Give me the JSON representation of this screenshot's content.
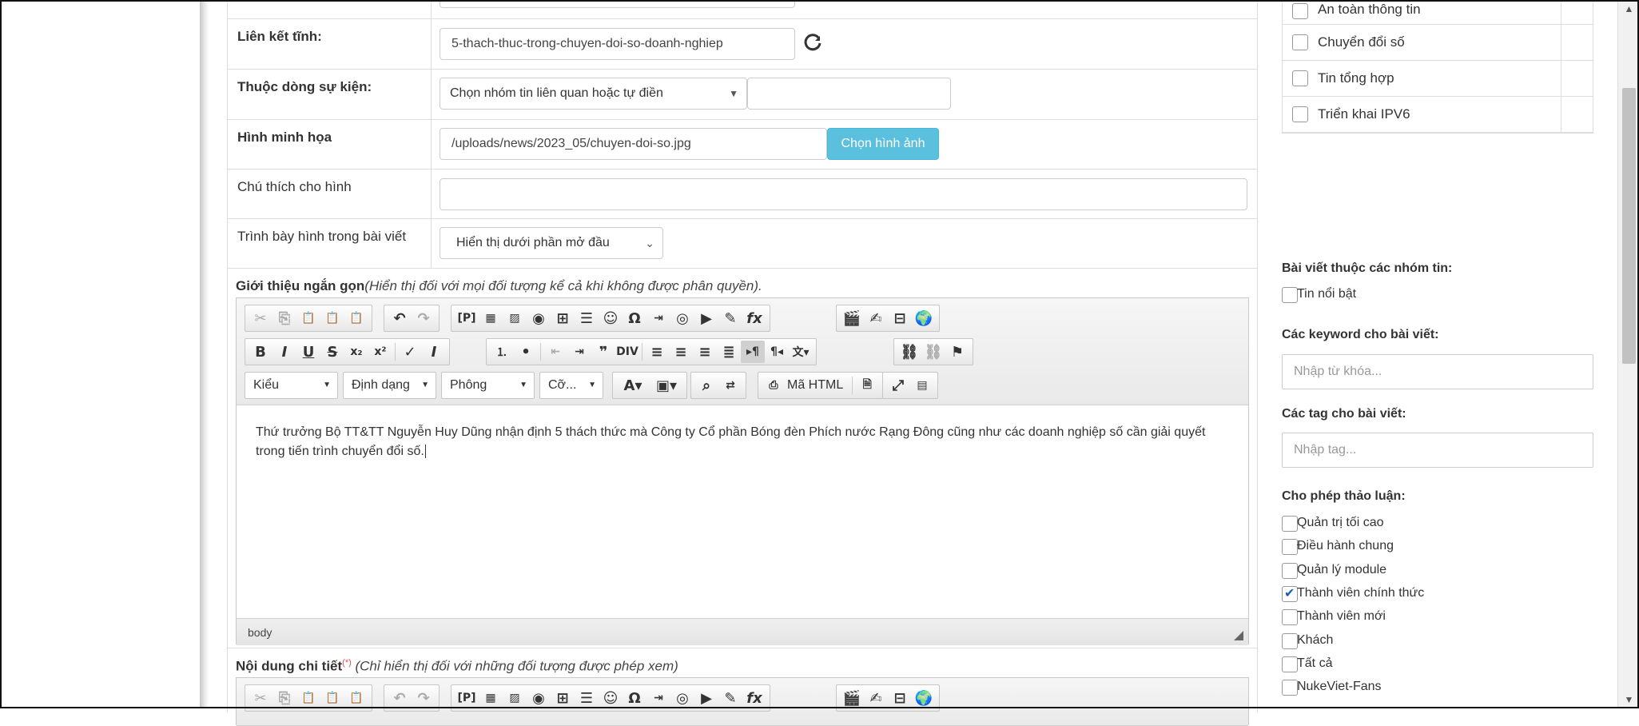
{
  "form": {
    "static_link_label": "Liên kết tĩnh:",
    "static_link_value": "5-thach-thuc-trong-chuyen-doi-so-doanh-nghiep",
    "refresh_icon": "refresh-icon",
    "event_stream_label": "Thuộc dòng sự kiện:",
    "event_stream_select": "Chọn nhóm tin liên quan hoặc tự điền",
    "event_stream_input": "",
    "image_label": "Hình minh họa",
    "image_value": "/uploads/news/2023_05/chuyen-doi-so.jpg",
    "image_button": "Chọn hình ảnh",
    "caption_label": "Chú thích cho hình",
    "caption_value": "",
    "image_position_label": "Trình bày hình trong bài viết",
    "image_position_select": "Hiển thị dưới phần mở đầu",
    "intro_title": "Giới thiệu ngắn gọn",
    "intro_hint": "(Hiển thị đối với mọi đối tượng kể cả khi không được phân quyền).",
    "detail_title": "Nội dung chi tiết",
    "detail_req": "(*)",
    "detail_hint": " (Chỉ hiển thị đối với những đối tượng được phép xem)"
  },
  "editor": {
    "combo_style": "Kiểu",
    "combo_format": "Định dạng",
    "combo_font": "Phông",
    "combo_size": "Cỡ...",
    "html_button": "Mã HTML",
    "content": "Thứ trưởng Bộ TT&TT Nguyễn Huy Dũng nhận định 5 thách thức mà Công ty Cổ phần Bóng đèn Phích nước Rạng Đông cũng như các doanh nghiệp số cần giải quyết trong tiến trình chuyển đổi số.",
    "status_path": "body"
  },
  "right": {
    "categories": [
      {
        "name": "An toàn thông tin",
        "checked": false
      },
      {
        "name": "Chuyển đổi số",
        "checked": false
      },
      {
        "name": "Tin tổng hợp",
        "checked": false
      },
      {
        "name": "Triển khai IPV6",
        "checked": false
      }
    ],
    "groups_heading": "Bài viết thuộc các nhóm tin:",
    "groups_item": "Tin nổi bật",
    "keywords_heading": "Các keyword cho bài viết:",
    "keywords_placeholder": "Nhập từ khóa...",
    "tags_heading": "Các tag cho bài viết:",
    "tags_placeholder": "Nhập tag...",
    "discuss_heading": "Cho phép thảo luận:",
    "discuss_items": [
      {
        "name": "Quản trị tối cao",
        "checked": false
      },
      {
        "name": "Điều hành chung",
        "checked": false
      },
      {
        "name": "Quản lý module",
        "checked": false
      },
      {
        "name": "Thành viên chính thức",
        "checked": true
      },
      {
        "name": "Thành viên mới",
        "checked": false
      },
      {
        "name": "Khách",
        "checked": false
      },
      {
        "name": "Tất cả",
        "checked": false
      },
      {
        "name": "NukeViet-Fans",
        "checked": false
      }
    ]
  }
}
